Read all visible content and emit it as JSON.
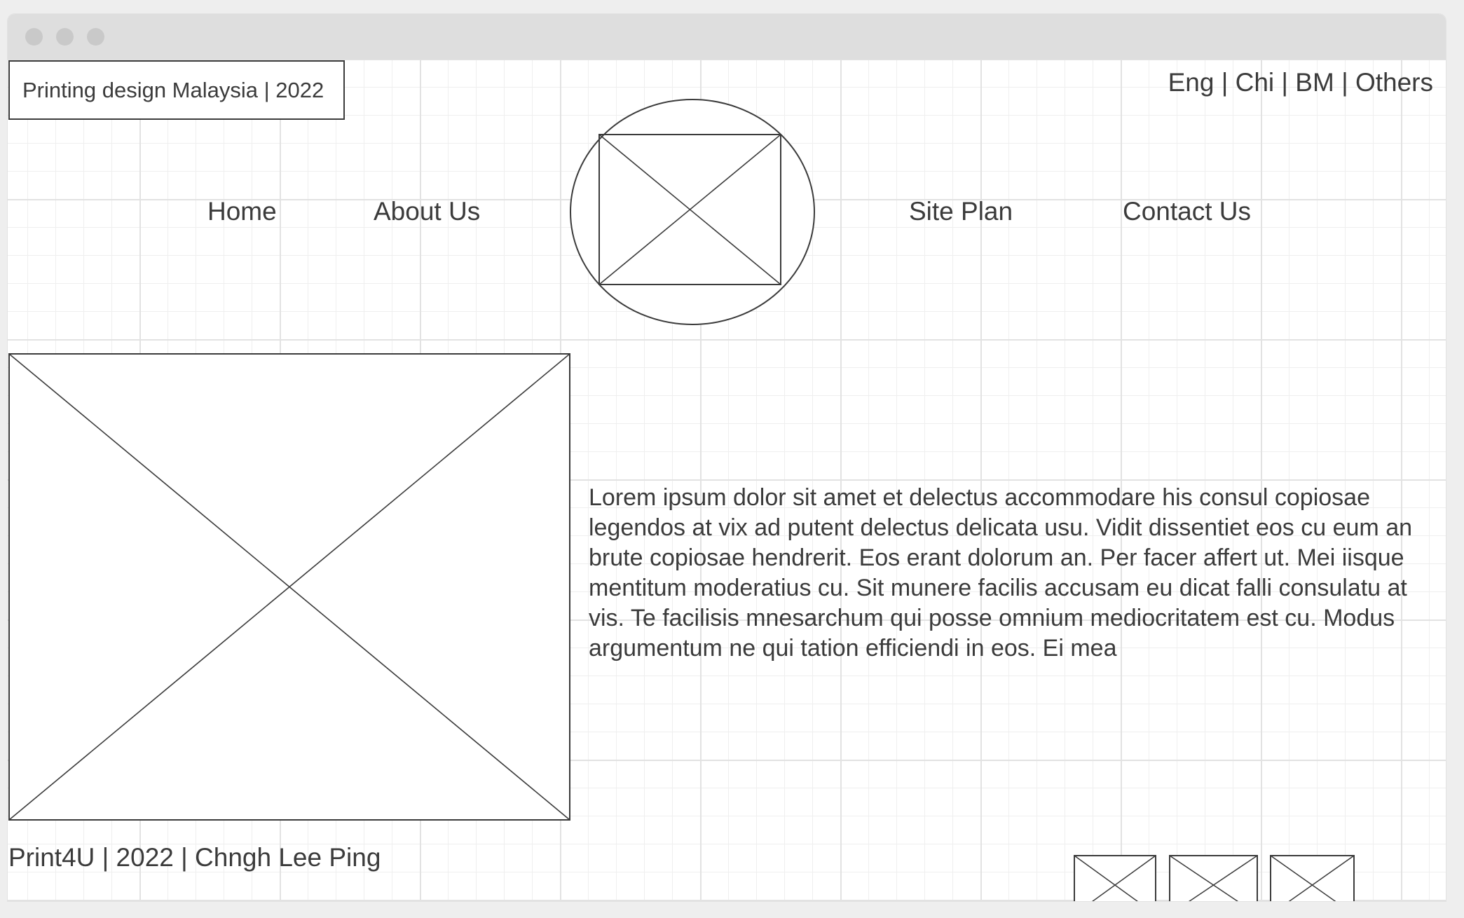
{
  "header": {
    "brand": "Printing design Malaysia | 2022",
    "languages": "Eng | Chi | BM | Others"
  },
  "nav": {
    "home": "Home",
    "about": "About Us",
    "site_plan": "Site Plan",
    "contact": "Contact Us"
  },
  "logo": {
    "icon": "image-placeholder-icon",
    "shape": "circle"
  },
  "hero": {
    "icon": "image-placeholder-icon"
  },
  "main": {
    "body_text": "Lorem ipsum dolor sit amet et delectus accommodare his consul copiosae legendos at vix ad putent delectus delicata usu. Vidit dissentiet eos cu eum an brute copiosae hendrerit. Eos erant dolorum an. Per facer affert ut. Mei iisque mentitum moderatius cu. Sit munere facilis accusam eu dicat falli consulatu at vis. Te facilisis mnesarchum qui posse omnium mediocritatem est cu. Modus argumentum ne qui tation efficiendi in eos. Ei mea"
  },
  "footer": {
    "text": "Print4U | 2022 | Chngh Lee Ping",
    "social_icons": [
      "image-placeholder-icon",
      "image-placeholder-icon",
      "image-placeholder-icon"
    ]
  },
  "colors": {
    "stroke": "#3b3b3b",
    "grid": "#e2e2e2",
    "titlebar": "#dedede"
  }
}
